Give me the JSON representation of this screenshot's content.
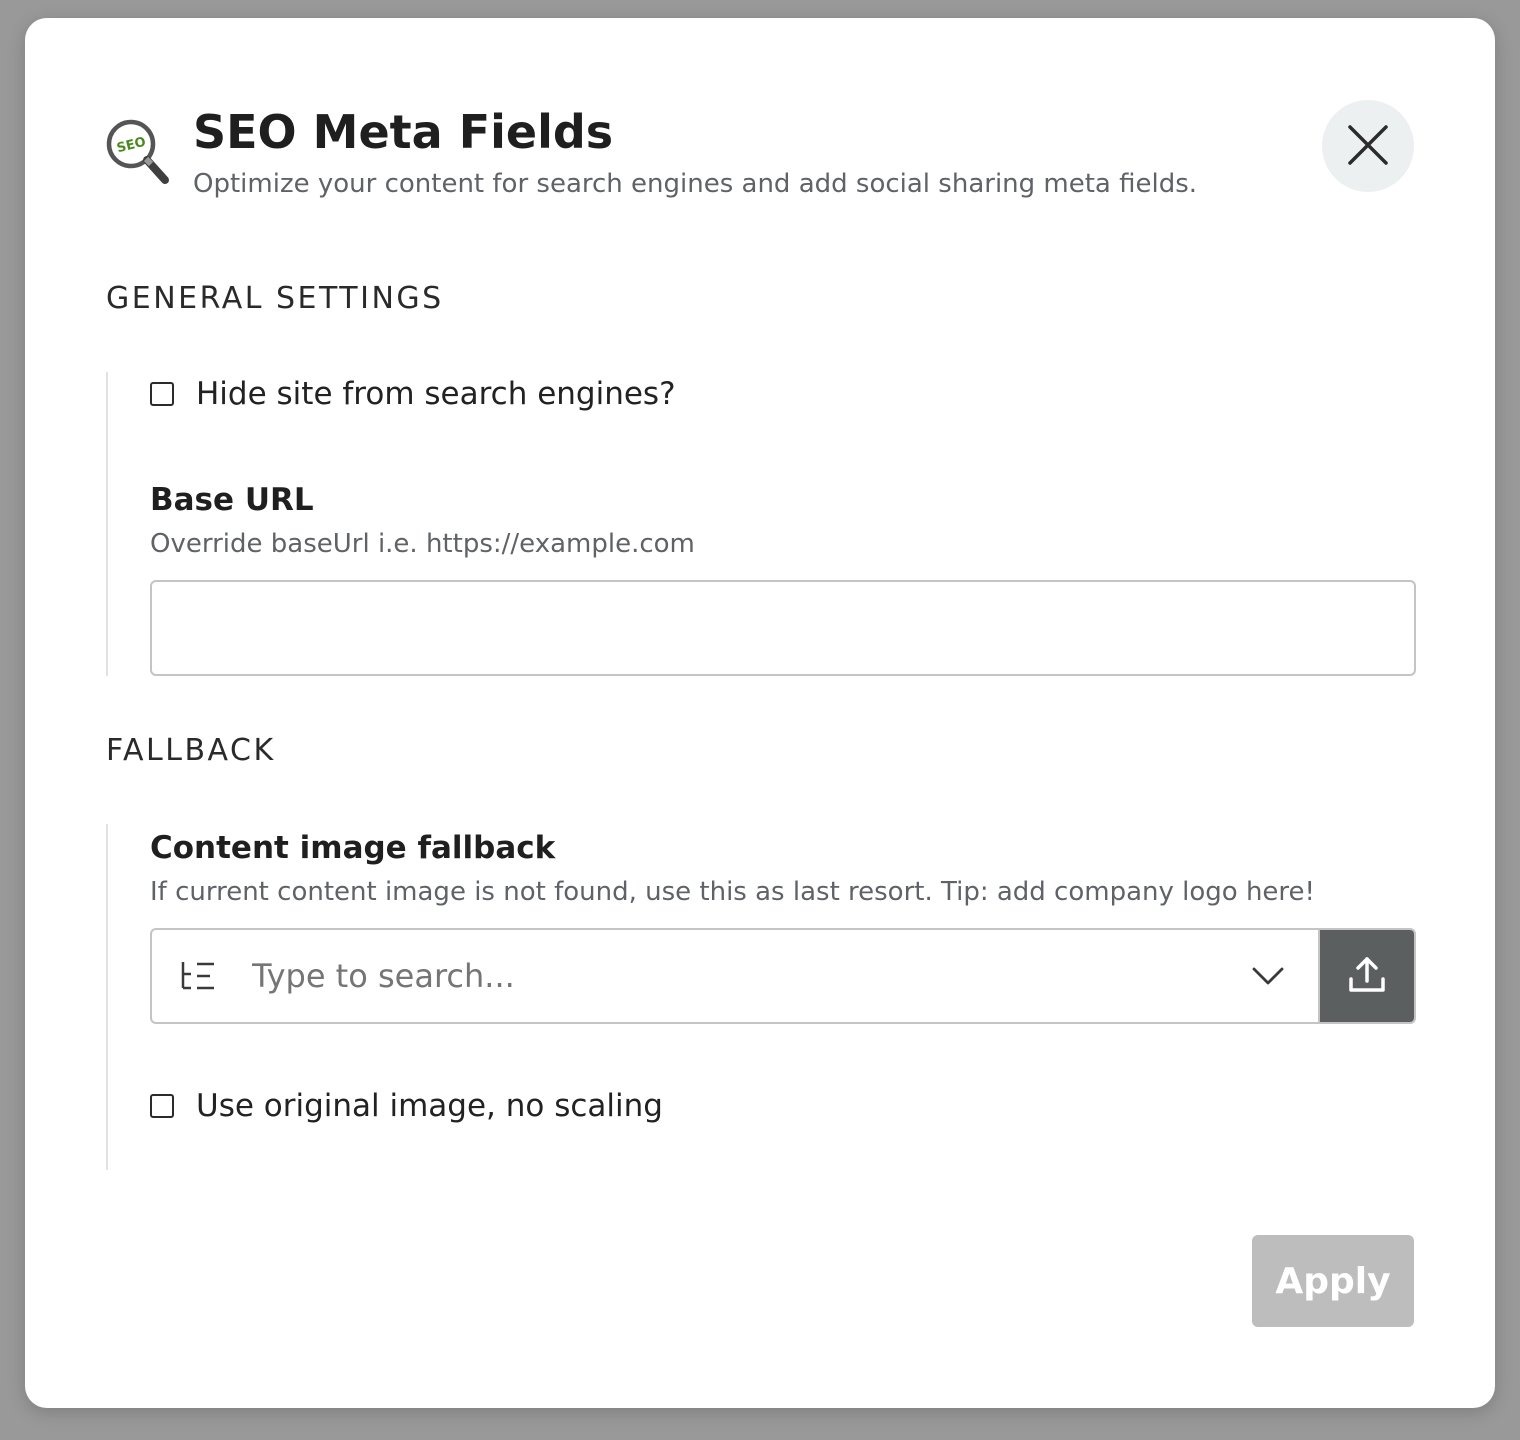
{
  "dialog": {
    "title": "SEO Meta Fields",
    "subtitle": "Optimize your content for search engines and add social sharing meta fields.",
    "logo_text": "SEO"
  },
  "general_settings": {
    "heading": "GENERAL SETTINGS",
    "hide_site_checkbox": {
      "label": "Hide site from search engines?",
      "checked": false
    },
    "base_url": {
      "label": "Base URL",
      "help": "Override baseUrl i.e. https://example.com",
      "value": ""
    }
  },
  "fallback": {
    "heading": "FALLBACK",
    "content_image": {
      "label": "Content image fallback",
      "help": "If current content image is not found, use this as last resort. Tip: add company logo here!",
      "placeholder": "Type to search..."
    },
    "original_image_checkbox": {
      "label": "Use original image, no scaling",
      "checked": false
    }
  },
  "footer": {
    "apply_label": "Apply"
  },
  "icons": {
    "logo": "seo-magnifier-icon",
    "close": "close-icon",
    "tree": "tree-list-icon",
    "chevron": "chevron-down-icon",
    "upload": "upload-icon"
  },
  "colors": {
    "backdrop": "#999999",
    "apply_disabled": "#bdbdbd",
    "upload_button": "#5c5f60",
    "close_button_bg": "#edf0f0",
    "logo_green": "#4a8a1c"
  }
}
